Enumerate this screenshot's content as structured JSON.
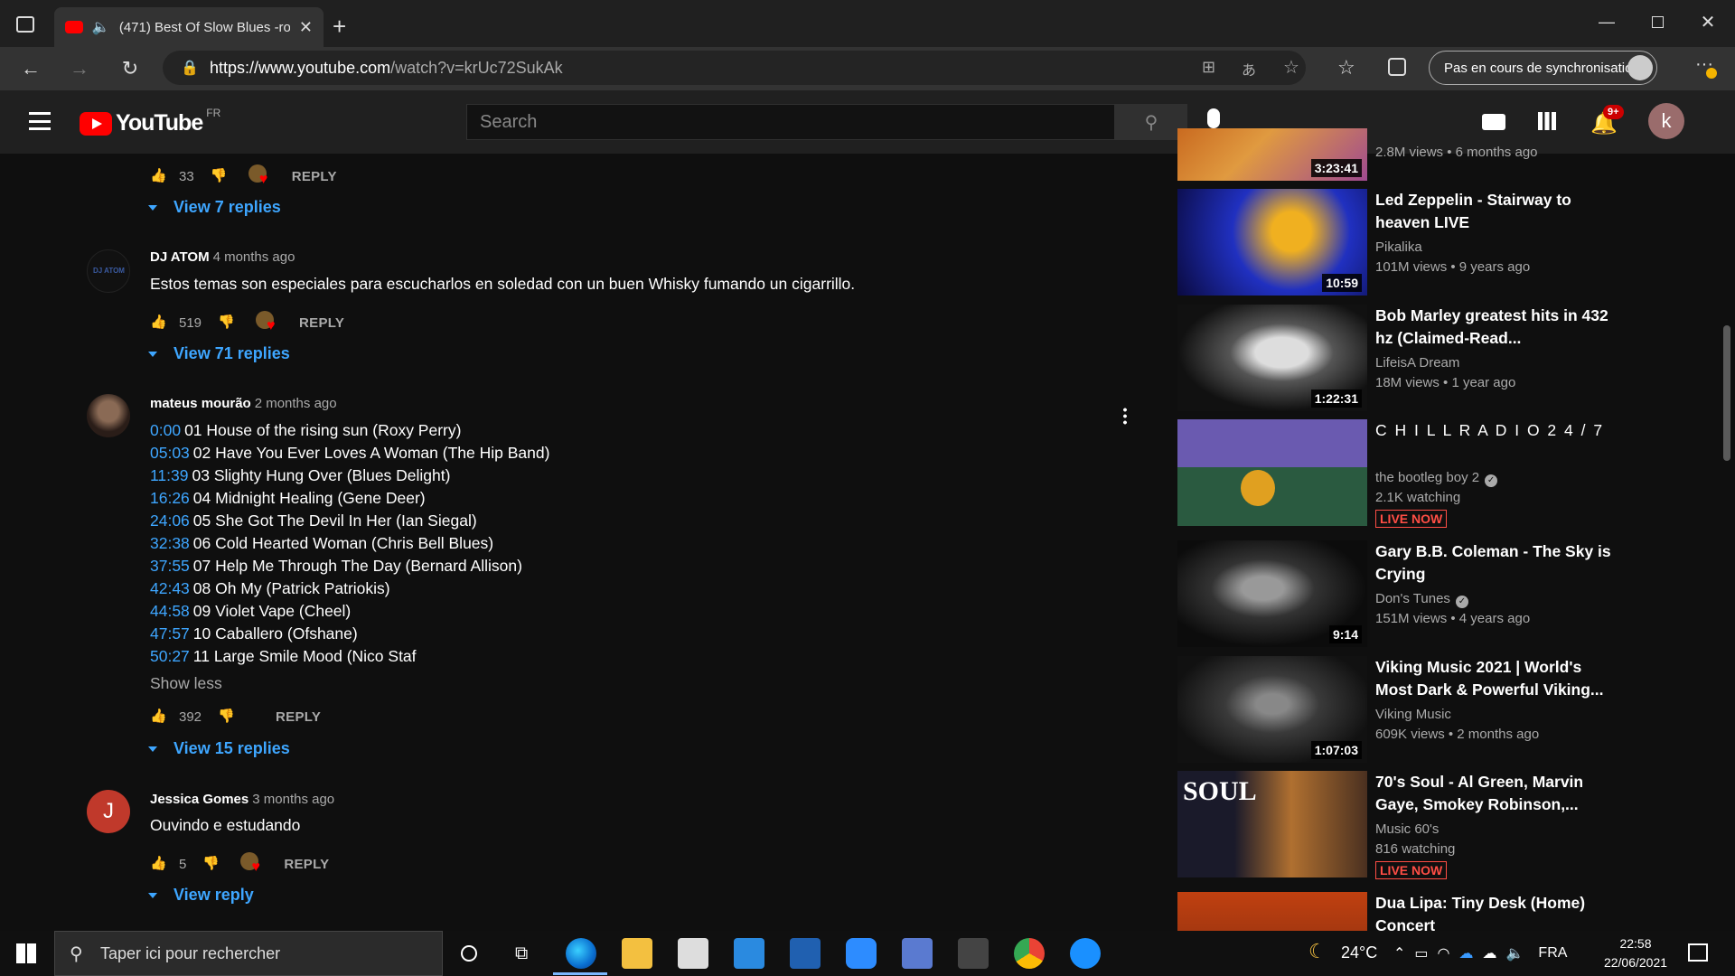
{
  "browser": {
    "tab_title": "(471) Best Of Slow Blues -ro",
    "url_host": "https://www.youtube.com",
    "url_path": "/watch?v=krUc72SukAk",
    "sync_label": "Pas en cours de synchronisation"
  },
  "youtube": {
    "logo_text": "YouTube",
    "country": "FR",
    "search_placeholder": "Search",
    "notif_badge": "9+",
    "account_initial": "k"
  },
  "comments": [
    {
      "likes": "33",
      "reply_label": "REPLY",
      "view_replies": "View 7 replies"
    },
    {
      "author": "DJ ATOM",
      "time": "4 months ago",
      "text": "Estos temas son especiales para escucharlos en soledad con un buen Whisky fumando un cigarrillo.",
      "likes": "519",
      "reply_label": "REPLY",
      "view_replies": "View 71 replies"
    },
    {
      "author": "mateus mourão",
      "time": "2 months ago",
      "tracks": [
        {
          "ts": "0:00",
          "title": "01 House of the rising sun (Roxy Perry)"
        },
        {
          "ts": "05:03",
          "title": "02 Have You Ever Loves A Woman (The Hip Band)"
        },
        {
          "ts": "11:39",
          "title": "03 Slighty Hung Over (Blues Delight)"
        },
        {
          "ts": "16:26",
          "title": "04 Midnight Healing (Gene Deer)"
        },
        {
          "ts": "24:06",
          "title": "05 She Got The Devil In Her (Ian Siegal)"
        },
        {
          "ts": "32:38",
          "title": "06 Cold Hearted Woman (Chris Bell Blues)"
        },
        {
          "ts": "37:55",
          "title": "07 Help Me Through The Day (Bernard Allison)"
        },
        {
          "ts": "42:43",
          "title": "08 Oh My (Patrick Patriokis)"
        },
        {
          "ts": "44:58",
          "title": "09 Violet Vape (Cheel)"
        },
        {
          "ts": "47:57",
          "title": "10 Caballero (Ofshane)"
        },
        {
          "ts": "50:27",
          "title": "11 Large Smile Mood (Nico Staf"
        }
      ],
      "show_less": "Show less",
      "likes": "392",
      "reply_label": "REPLY",
      "view_replies": "View 15 replies"
    },
    {
      "author": "Jessica Gomes",
      "time": "3 months ago",
      "avatar_initial": "J",
      "text": "Ouvindo e estudando",
      "likes": "5",
      "reply_label": "REPLY",
      "view_replies": "View reply"
    }
  ],
  "sidebar": [
    {
      "duration": "3:23:41",
      "meta": "2.8M views • 6 months ago"
    },
    {
      "title": "Led Zeppelin - Stairway to heaven LIVE",
      "channel": "Pikalika",
      "meta": "101M views • 9 years ago",
      "duration": "10:59"
    },
    {
      "title": "Bob Marley greatest hits in 432 hz (Claimed-Read...",
      "channel": "LifeisA Dream",
      "meta": "18M views • 1 year ago",
      "duration": "1:22:31"
    },
    {
      "title": "C H I L L   R A D I O 2 4 / 7",
      "channel": "the bootleg boy 2",
      "meta": "2.1K watching",
      "live": "LIVE NOW"
    },
    {
      "title": "Gary B.B. Coleman - The Sky is Crying",
      "channel": "Don's Tunes",
      "meta": "151M views • 4 years ago",
      "duration": "9:14"
    },
    {
      "title": "Viking Music 2021 | World's Most Dark & Powerful Viking...",
      "channel": "Viking Music",
      "meta": "609K views • 2 months ago",
      "duration": "1:07:03"
    },
    {
      "title": "70's Soul - Al Green, Marvin Gaye, Smokey Robinson,...",
      "channel": "Music 60's",
      "meta": "816 watching",
      "live": "LIVE NOW",
      "thumb_text": "SOUL"
    },
    {
      "title": "Dua Lipa: Tiny Desk (Home) Concert"
    }
  ],
  "taskbar": {
    "search_placeholder": "Taper ici pour rechercher",
    "temperature": "24°C",
    "language": "FRA",
    "time": "22:58",
    "date": "22/06/2021"
  }
}
